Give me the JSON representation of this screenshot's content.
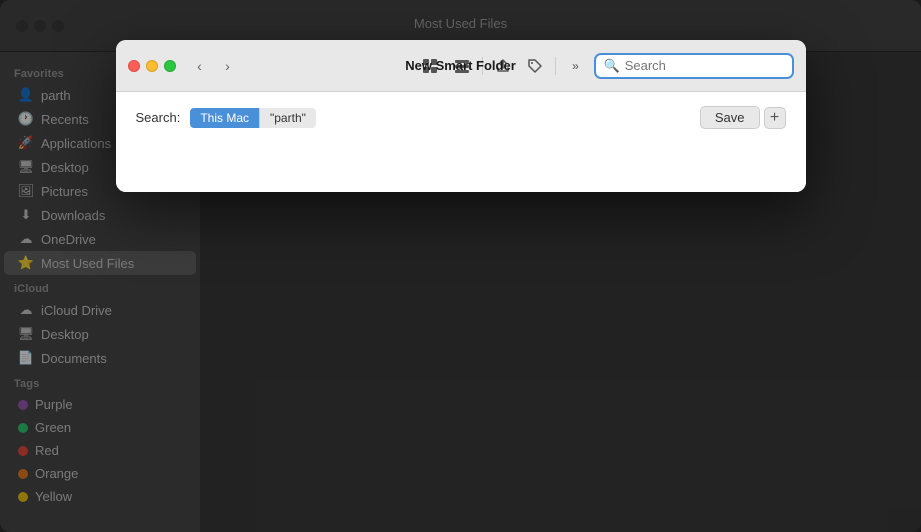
{
  "background": {
    "title": "Most Used Files",
    "sidebar": {
      "sections": [
        {
          "label": "Favorites",
          "items": [
            {
              "name": "parth",
              "icon": "👤",
              "type": "user"
            },
            {
              "name": "Recents",
              "icon": "🕐",
              "type": "recents"
            },
            {
              "name": "Applications",
              "icon": "📱",
              "type": "apps"
            },
            {
              "name": "Desktop",
              "icon": "🖥",
              "type": "desktop"
            },
            {
              "name": "Pictures",
              "icon": "🖼",
              "type": "pictures"
            },
            {
              "name": "Downloads",
              "icon": "⬇",
              "type": "downloads"
            },
            {
              "name": "OneDrive",
              "icon": "☁",
              "type": "onedrive"
            },
            {
              "name": "Most Used Files",
              "icon": "⭐",
              "type": "smart",
              "active": true
            }
          ]
        },
        {
          "label": "iCloud",
          "items": [
            {
              "name": "iCloud Drive",
              "icon": "☁",
              "type": "icloud"
            },
            {
              "name": "Desktop",
              "icon": "🖥",
              "type": "desktop"
            },
            {
              "name": "Documents",
              "icon": "📄",
              "type": "documents"
            }
          ]
        },
        {
          "label": "Tags",
          "items": [
            {
              "name": "Purple",
              "color": "#9b59b6",
              "type": "tag"
            },
            {
              "name": "Green",
              "color": "#2ecc71",
              "type": "tag"
            },
            {
              "name": "Red",
              "color": "#e74c3c",
              "type": "tag"
            },
            {
              "name": "Orange",
              "color": "#e67e22",
              "type": "tag"
            },
            {
              "name": "Yellow",
              "color": "#f1c40f",
              "type": "tag"
            }
          ]
        }
      ]
    }
  },
  "modal": {
    "title": "New Smart Folder",
    "nav": {
      "back_label": "‹",
      "forward_label": "›"
    },
    "toolbar": {
      "icons": [
        "grid-icon",
        "list-icon",
        "share-icon",
        "tag-icon"
      ],
      "more_label": "»"
    },
    "search": {
      "placeholder": "Search",
      "value": ""
    },
    "criteria": {
      "search_label": "Search:",
      "location_token": "This Mac",
      "query_token": "\"parth\""
    },
    "save_label": "Save",
    "add_label": "+"
  }
}
